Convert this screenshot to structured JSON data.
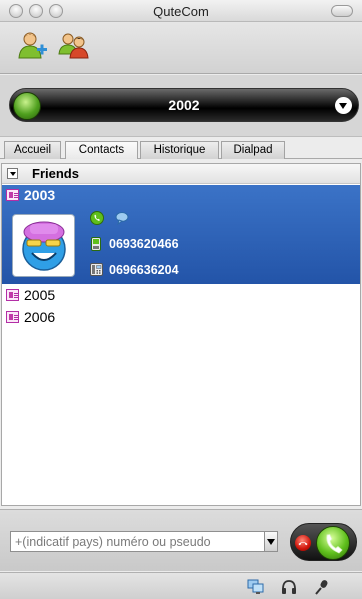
{
  "window": {
    "title": "QuteCom"
  },
  "toolbar": {
    "items": [
      {
        "icon": "add-contact-icon"
      },
      {
        "icon": "contacts-group-icon"
      }
    ]
  },
  "account": {
    "name": "2002",
    "status_color": "#4fa01e"
  },
  "tabs": [
    {
      "label": "Accueil",
      "active": false
    },
    {
      "label": "Contacts",
      "active": true
    },
    {
      "label": "Historique",
      "active": false
    },
    {
      "label": "Dialpad",
      "active": false
    }
  ],
  "contacts": {
    "group_name": "Friends",
    "selected": {
      "name": "2003",
      "mobile": "0693620466",
      "phone": "0696636204"
    },
    "others": [
      {
        "name": "2005"
      },
      {
        "name": "2006"
      }
    ]
  },
  "dial": {
    "placeholder": "+(indicatif pays) numéro ou pseudo"
  },
  "colors": {
    "selection": "#2d5fb5",
    "call_green": "#5fbf1c",
    "hangup_red": "#d0140a"
  }
}
